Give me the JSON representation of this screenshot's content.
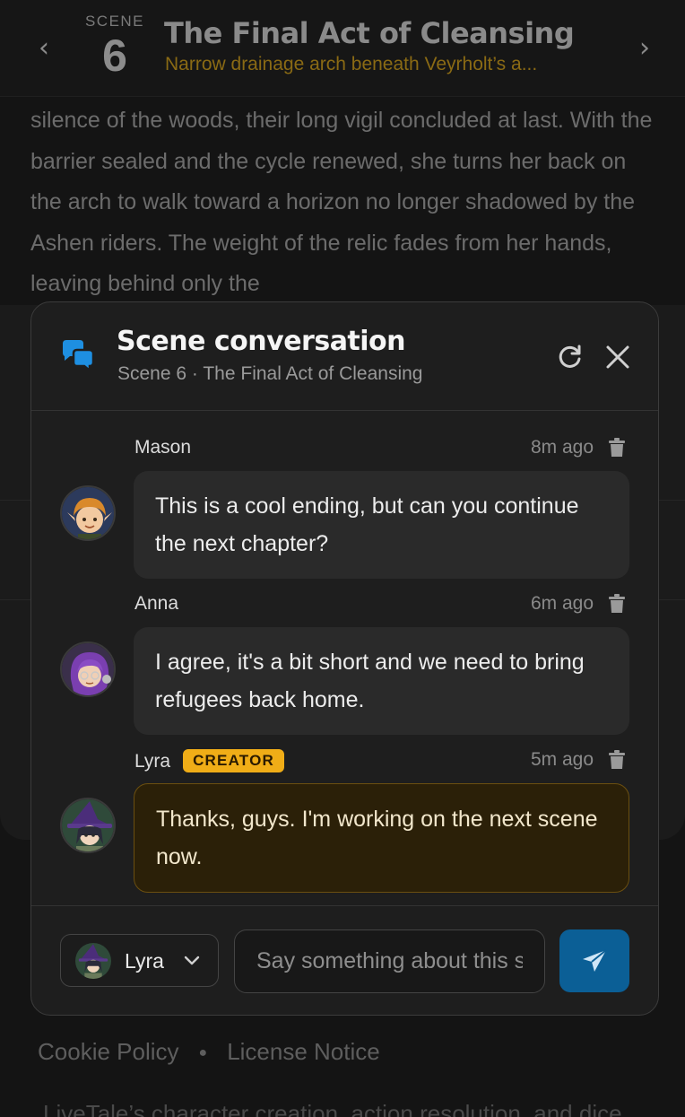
{
  "header": {
    "prev_icon": "chevron-left-icon",
    "next_icon": "chevron-right-icon",
    "scene_label": "SCENE",
    "scene_number": "6",
    "title": "The Final Act of Cleansing",
    "subtitle": "Narrow drainage arch beneath Veyrholt’s a..."
  },
  "story": {
    "text": "silence of the woods, their long vigil concluded at last. With the barrier sealed and the cycle renewed, she turns her back on the arch to walk toward a horizon no longer shadowed by the Ashen riders. The weight of the relic fades from her hands, leaving behind only the"
  },
  "footer": {
    "links": [
      "Cookie Policy",
      "License Notice"
    ],
    "text": "LiveTale’s character creation, action resolution, and dice"
  },
  "modal": {
    "icon": "chat-bubbles-icon",
    "title": "Scene conversation",
    "subtitle": "Scene 6 · The Final Act of Cleansing",
    "refresh_icon": "refresh-icon",
    "close_icon": "close-icon",
    "messages": [
      {
        "author": "Mason",
        "time": "8m ago",
        "text": "This is a cool ending, but can you continue the next chapter?",
        "is_creator": false
      },
      {
        "author": "Anna",
        "time": "6m ago",
        "text": "I agree, it's a bit short and we need to bring refugees back home.",
        "is_creator": false
      },
      {
        "author": "Lyra",
        "badge": "CREATOR",
        "time": "5m ago",
        "text": "Thanks, guys. I'm working on the next scene now.",
        "is_creator": true
      }
    ],
    "composer": {
      "persona": "Lyra",
      "placeholder": "Say something about this scene",
      "send_icon": "send-icon"
    }
  },
  "colors": {
    "accent_gold": "#f0ad17",
    "accent_blue": "#0b5f96",
    "chat_icon_blue": "#1e8fe1"
  }
}
